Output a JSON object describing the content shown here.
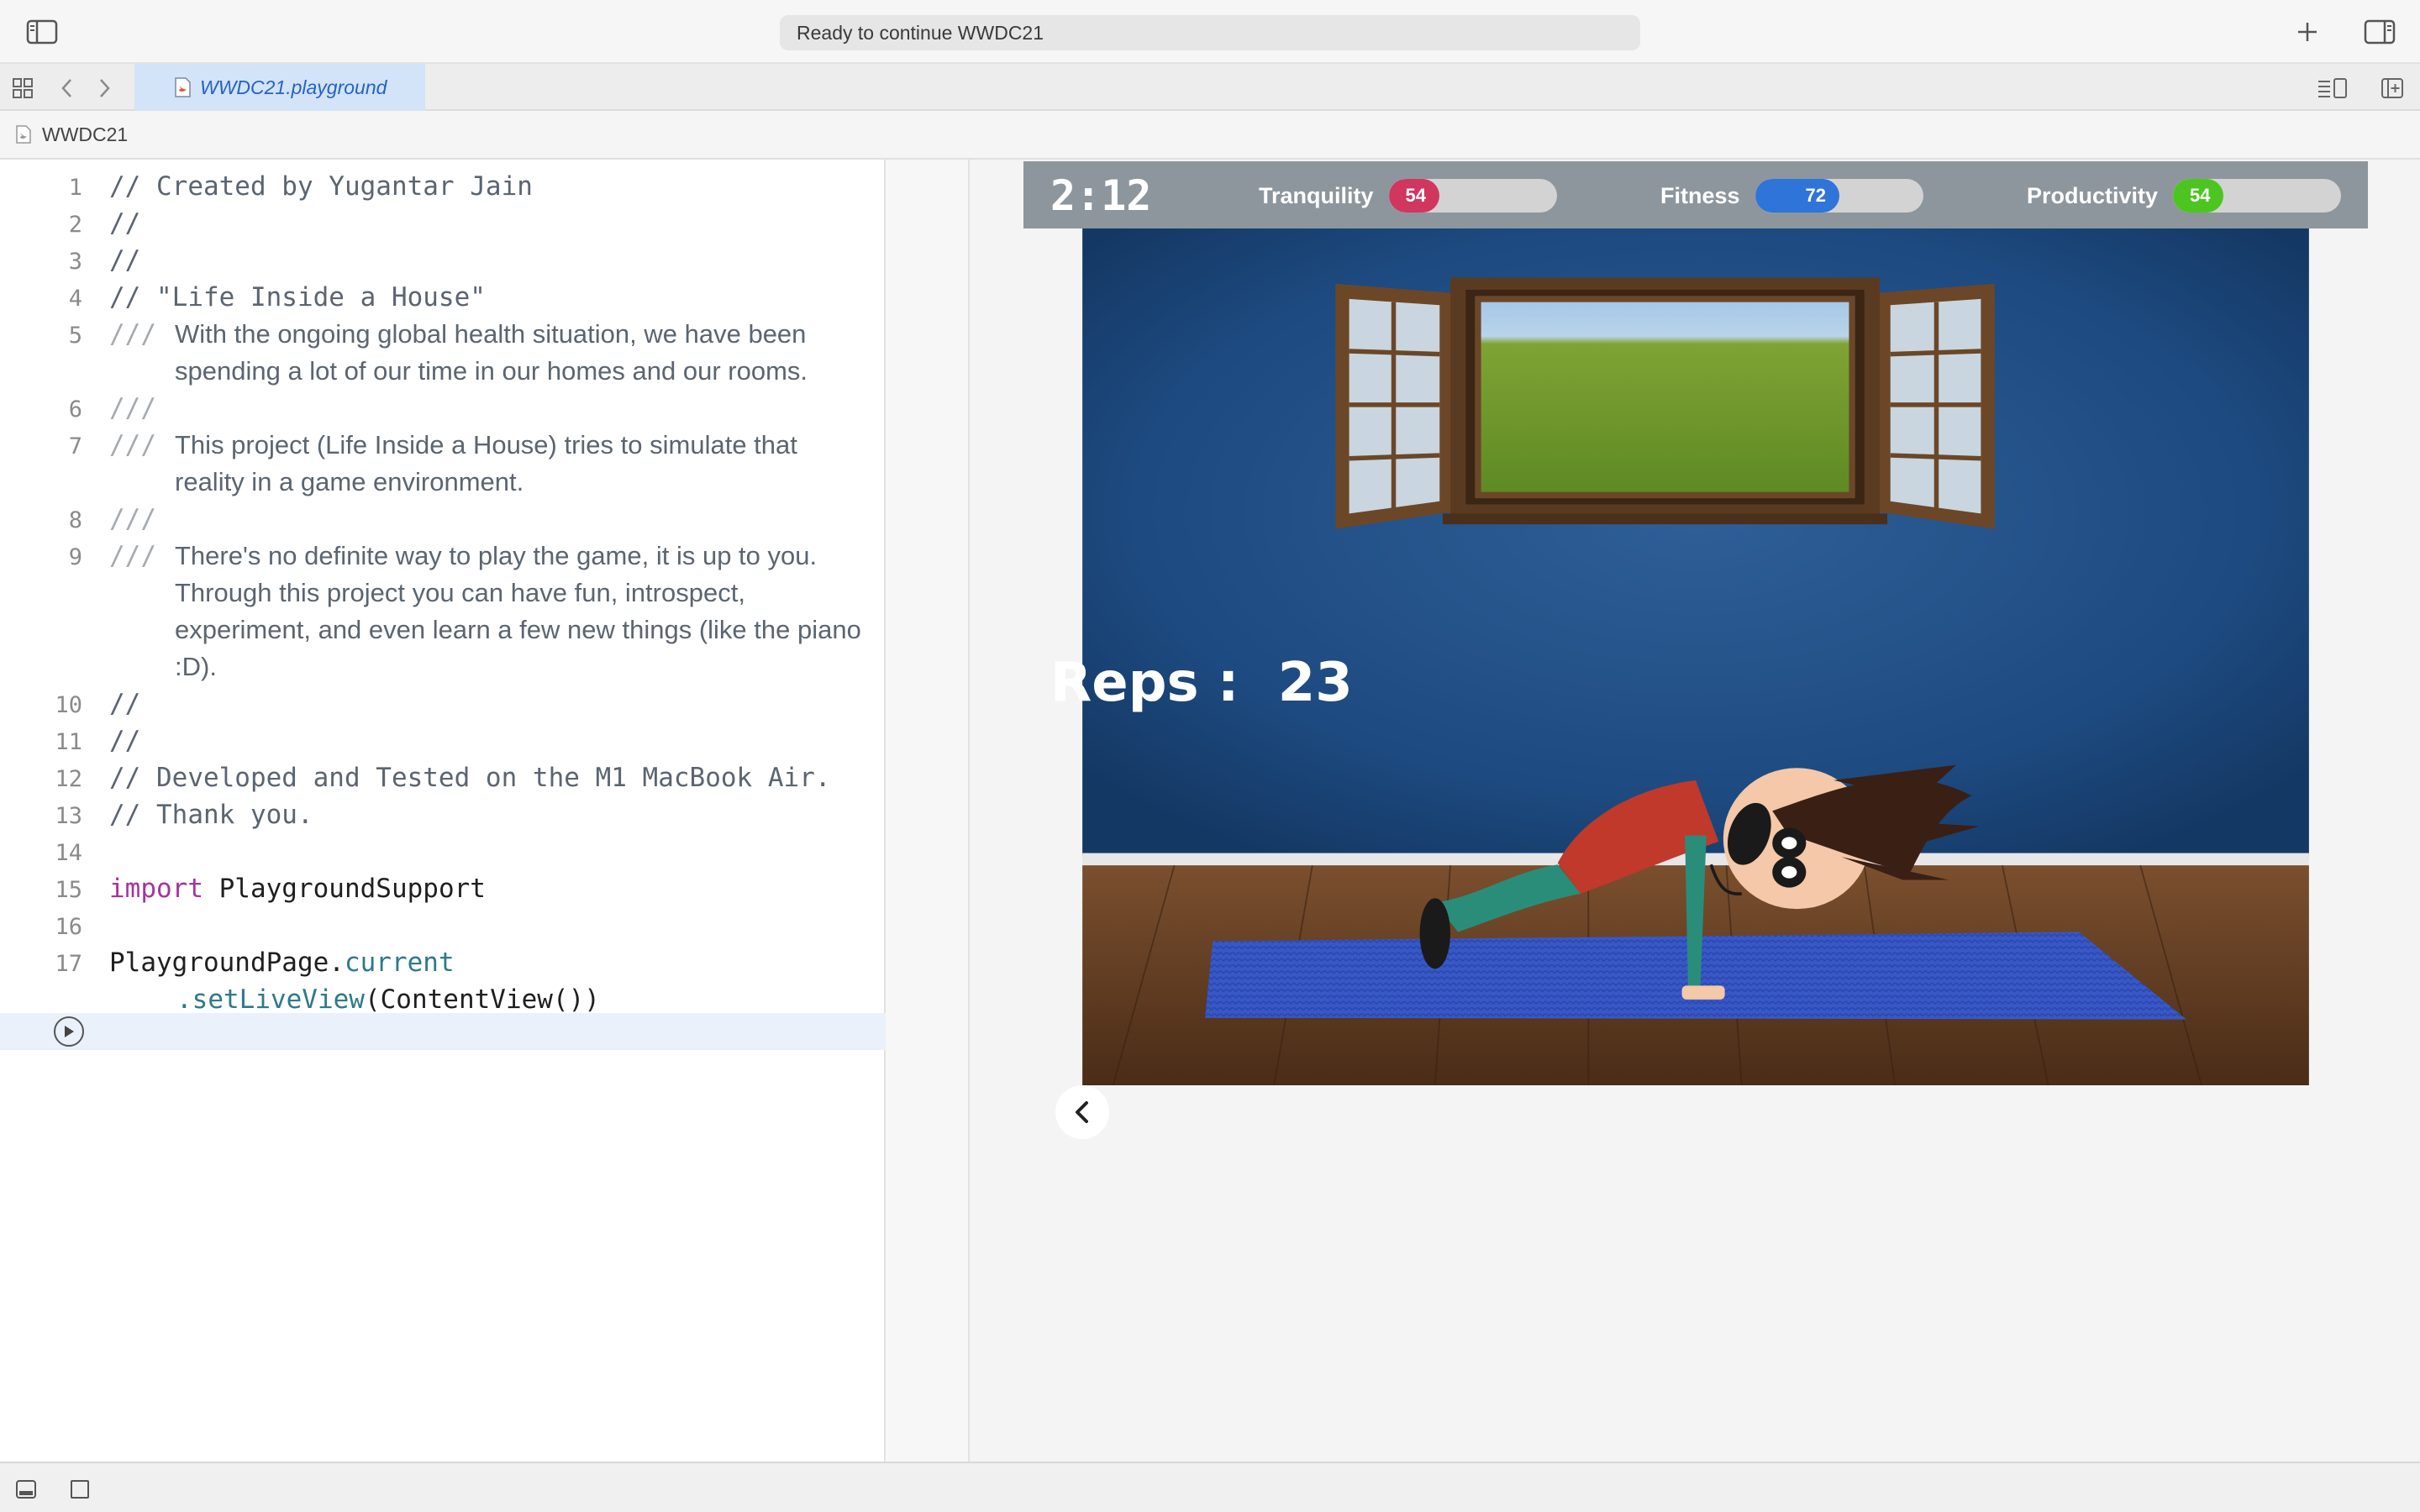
{
  "toolbar": {
    "status_text": "Ready to continue WWDC21"
  },
  "tabs": [
    {
      "label": "WWDC21.playground",
      "active": true
    }
  ],
  "breadcrumb": {
    "project": "WWDC21"
  },
  "editor": {
    "lines": [
      {
        "n": "1",
        "text": "// Created by Yugantar Jain"
      },
      {
        "n": "2",
        "text": "//"
      },
      {
        "n": "3",
        "text": "//"
      },
      {
        "n": "4",
        "text": "// \"Life Inside a House\""
      },
      {
        "n": "5",
        "slashes": "///",
        "text": "With the ongoing global health situation, we have been spending a lot of our time in our homes and our rooms."
      },
      {
        "n": "6",
        "slashes": "///"
      },
      {
        "n": "7",
        "slashes": "///",
        "text": "This project (Life Inside a House) tries to simulate that reality in a game environment."
      },
      {
        "n": "8",
        "slashes": "///"
      },
      {
        "n": "9",
        "slashes": "///",
        "text": "There's no definite way to play the game, it is up to you. Through this project you can have fun, introspect, experiment, and even learn a few new things (like the piano :D)."
      },
      {
        "n": "10",
        "text": "//"
      },
      {
        "n": "11",
        "text": "//"
      },
      {
        "n": "12",
        "text": "// Developed and Tested on the M1 MacBook Air."
      },
      {
        "n": "13",
        "text": "// Thank you."
      },
      {
        "n": "14"
      },
      {
        "n": "15",
        "keyword": "import",
        "rest": " PlaygroundSupport"
      },
      {
        "n": "16"
      },
      {
        "n": "17",
        "obj": "PlaygroundPage.",
        "prop": "current"
      },
      {
        "cont_prop": ".setLiveView",
        "cont_rest": "(ContentView())"
      }
    ]
  },
  "game": {
    "timer": "2:12",
    "meters": [
      {
        "label": "Tranquility",
        "value": "54",
        "fraction": 0.3,
        "color": "#d1365f"
      },
      {
        "label": "Fitness",
        "value": "72",
        "fraction": 0.5,
        "color": "#2f74d8"
      },
      {
        "label": "Productivity",
        "value": "54",
        "fraction": 0.3,
        "color": "#4cc520"
      }
    ],
    "reps_label": "Reps :",
    "reps_value": "23"
  },
  "colors": {
    "accent": "#2563c9",
    "wall": "#1f4f85",
    "floor": "#6b4326",
    "mat": "#3656c4"
  }
}
